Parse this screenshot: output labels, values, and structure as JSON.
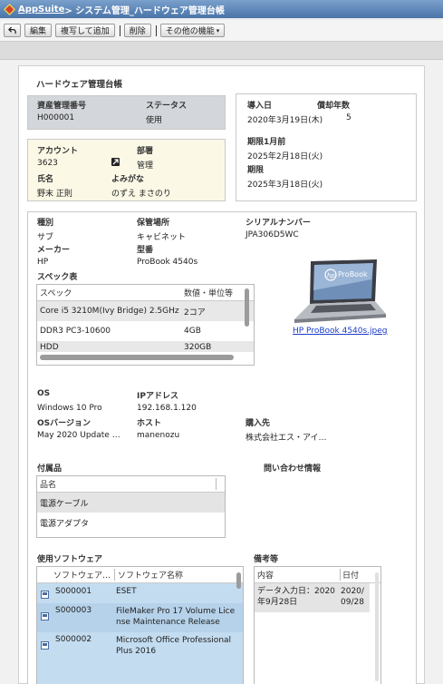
{
  "titlebar": {
    "app_name": "AppSuite",
    "path": " > システム管理_ハードウェア管理台帳"
  },
  "toolbar": {
    "edit": "編集",
    "duplicate": "複写して追加",
    "delete": "削除",
    "more": "その他の機能"
  },
  "form": {
    "title": "ハードウェア管理台帳"
  },
  "asset": {
    "number_label": "資産管理番号",
    "number": "H000001",
    "status_label": "ステータス",
    "status": "使用"
  },
  "dates": {
    "intro_label": "導入日",
    "intro": "2020年3月19日(木)",
    "dep_label": "償却年数",
    "dep": "5",
    "deadline1_label": "期限1月前",
    "deadline1": "2025年2月18日(火)",
    "deadline_label": "期限",
    "deadline": "2025年3月18日(火)"
  },
  "account": {
    "account_label": "アカウント",
    "account": "3623",
    "dept_label": "部署",
    "dept": "管理",
    "name_label": "氏名",
    "name": "野末 正則",
    "kana_label": "よみがな",
    "kana": "のずえ まさのり"
  },
  "device": {
    "type_label": "種別",
    "type": "サブ",
    "location_label": "保管場所",
    "location": "キャビネット",
    "serial_label": "シリアルナンバー",
    "serial": "JPA306D5WC",
    "maker_label": "メーカー",
    "maker": "HP",
    "model_label": "型番",
    "model": "ProBook 4540s",
    "image_file": "HP ProBook 4540s.jpeg",
    "laptop_brand": "ProBook"
  },
  "spec": {
    "title": "スペック表",
    "headers": [
      "スペック",
      "数値・単位等"
    ],
    "rows": [
      [
        "Core i5 3210M(Ivy Bridge) 2.5GHz",
        "2コア"
      ],
      [
        "DDR3 PC3-10600",
        "4GB"
      ],
      [
        "HDD",
        "320GB"
      ]
    ]
  },
  "os": {
    "os_label": "OS",
    "os": "Windows 10 Pro",
    "ip_label": "IPアドレス",
    "ip": "192.168.1.120",
    "ver_label": "OSバージョン",
    "ver": "May 2020 Update …",
    "host_label": "ホスト",
    "host": "manenozu",
    "vendor_label": "購入先",
    "vendor": "株式会社エス・アイ…"
  },
  "accessories": {
    "title": "付属品",
    "header": "品名",
    "rows": [
      "電源ケーブル",
      "電源アダプタ"
    ]
  },
  "contact": {
    "title": "問い合わせ情報"
  },
  "software": {
    "title": "使用ソフトウェア",
    "headers": [
      "ソフトウェア…",
      "ソフトウェア名称"
    ],
    "rows": [
      {
        "code": "S000001",
        "name": "ESET"
      },
      {
        "code": "S000003",
        "name": "FileMaker Pro 17 Volume License Maintenance Release"
      },
      {
        "code": "S000002",
        "name": "Microsoft Office Professional Plus 2016"
      }
    ]
  },
  "notes": {
    "title": "備考等",
    "headers": [
      "内容",
      "日付"
    ],
    "rows": [
      {
        "content": "データ入力日：2020年9月28日",
        "date": "2020/09/28"
      }
    ]
  }
}
